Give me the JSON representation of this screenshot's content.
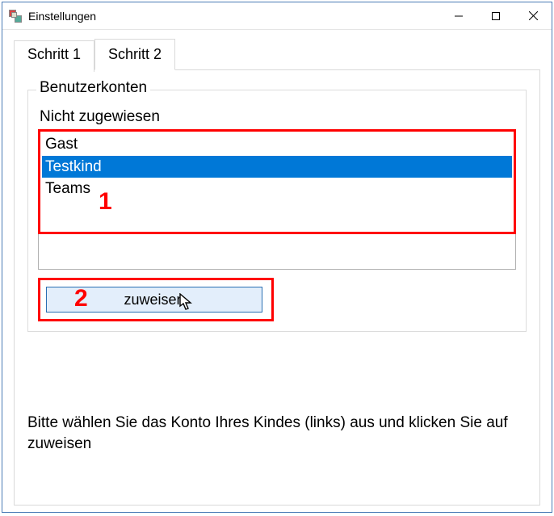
{
  "window": {
    "title": "Einstellungen"
  },
  "tabs": {
    "tab1": "Schritt 1",
    "tab2": "Schritt 2"
  },
  "group": {
    "legend": "Benutzerkonten",
    "sublabel": "Nicht zugewiesen"
  },
  "list": {
    "items": [
      {
        "label": "Gast"
      },
      {
        "label": "Testkind"
      },
      {
        "label": "Teams"
      }
    ]
  },
  "buttons": {
    "assign": "zuweisen"
  },
  "info": {
    "text": "Bitte wählen Sie das Konto Ihres Kindes (links) aus und klicken Sie auf zuweisen"
  },
  "annotations": {
    "num1": "1",
    "num2": "2"
  }
}
